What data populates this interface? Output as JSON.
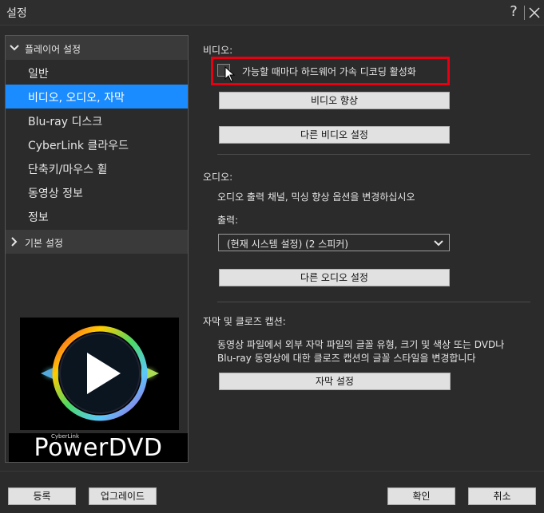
{
  "window": {
    "title": "설정",
    "help_label": "?"
  },
  "sidebar": {
    "group1": {
      "label": "플레이어 설정"
    },
    "items": [
      {
        "label": "일반"
      },
      {
        "label": "비디오, 오디오, 자막"
      },
      {
        "label": "Blu-ray 디스크"
      },
      {
        "label": "CyberLink 클라우드"
      },
      {
        "label": "단축키/마우스 휠"
      },
      {
        "label": "동영상 정보"
      },
      {
        "label": "정보"
      }
    ],
    "group2": {
      "label": "기본 설정"
    },
    "brand": {
      "small": "CyberLink",
      "name": "PowerDVD"
    }
  },
  "video": {
    "title": "비디오:",
    "hw_decode_label": "가능할 때마다 하드웨어 가속 디코딩 활성화",
    "enhance_button": "비디오 향상",
    "other_button": "다른 비디오 설정"
  },
  "audio": {
    "title": "오디오:",
    "description": "오디오 출력 채널, 믹싱 향상 옵션을 변경하십시오",
    "output_label": "출력:",
    "output_value": "(현재 시스템 설정) (2 스피커)",
    "other_button": "다른 오디오 설정"
  },
  "subtitle": {
    "title": "자막 및 클로즈 캡션:",
    "description_line1": "동영상 파일에서 외부 자막 파일의 글꼴 유형, 크기 및 색상 또는 DVD나",
    "description_line2": "Blu-ray 동영상에 대한 클로즈 캡션의 글꼴 스타일을 변경합니다",
    "settings_button": "자막 설정"
  },
  "footer": {
    "register": "등록",
    "upgrade": "업그레이드",
    "ok": "확인",
    "cancel": "취소"
  },
  "colors": {
    "accent": "#1a8cff",
    "highlight": "#e60012",
    "background": "#2b2b2b"
  }
}
